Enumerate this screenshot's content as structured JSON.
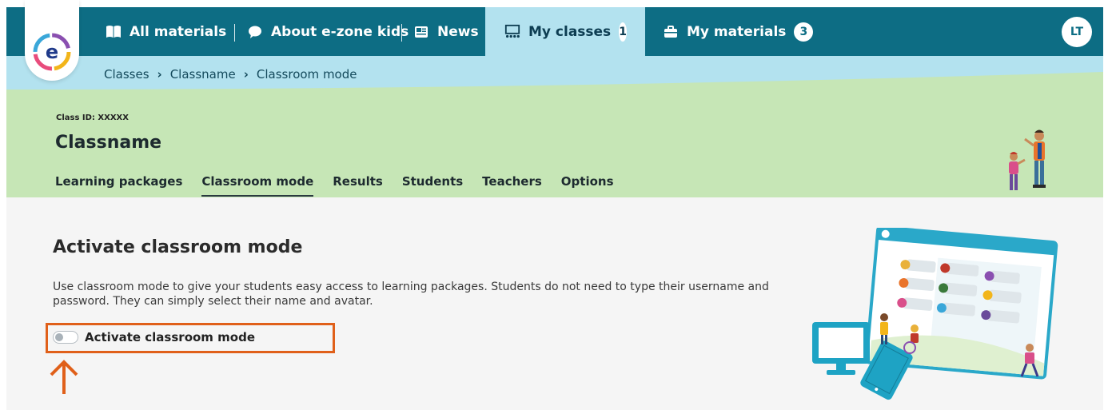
{
  "nav": {
    "items": [
      {
        "label": "All materials",
        "icon": "book-icon"
      },
      {
        "label": "About e-zone kids",
        "icon": "speech-bubble-icon"
      },
      {
        "label": "News",
        "icon": "newspaper-icon"
      },
      {
        "label": "My classes",
        "icon": "classroom-icon",
        "badge": "1",
        "active": true
      },
      {
        "label": "My materials",
        "icon": "briefcase-icon",
        "badge": "3"
      }
    ],
    "avatar": "LT"
  },
  "logo": {
    "letter": "e"
  },
  "breadcrumb": [
    "Classes",
    "Classname",
    "Classroom mode"
  ],
  "class_header": {
    "class_id": "Class ID: XXXXX",
    "name": "Classname",
    "tabs": [
      "Learning packages",
      "Classroom mode",
      "Results",
      "Students",
      "Teachers",
      "Options"
    ],
    "active_tab": "Classroom mode"
  },
  "main": {
    "title": "Activate classroom mode",
    "description": "Use classroom mode to give your students easy access to learning  packages. Students do not need to type their username and password. They can simply select their name and avatar.",
    "toggle_label": "Activate classroom mode",
    "toggle_on": false
  },
  "colors": {
    "nav_bg": "#0d6d84",
    "breadcrumb_bg": "#b3e2ef",
    "header_bg": "#c6e6b6",
    "highlight": "#e0601a"
  }
}
